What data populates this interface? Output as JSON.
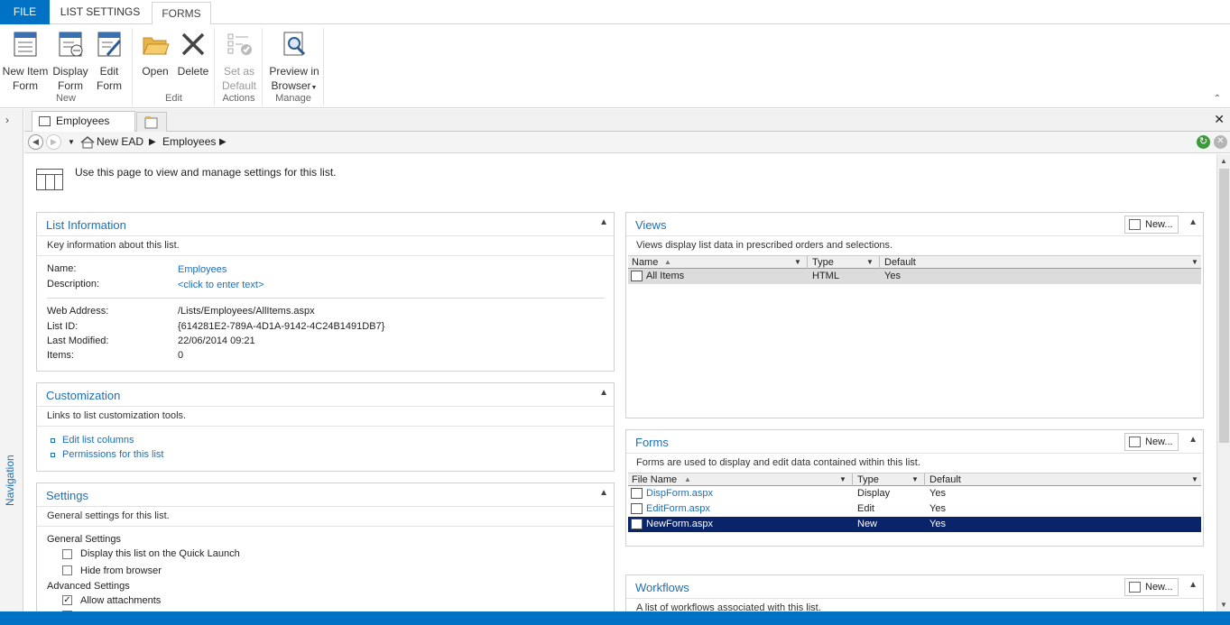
{
  "ribbon": {
    "tabs": [
      "FILE",
      "LIST SETTINGS",
      "FORMS"
    ],
    "groups": {
      "new": {
        "label": "New",
        "new_item_form": [
          "New Item",
          "Form"
        ],
        "display_form": [
          "Display",
          "Form"
        ],
        "edit_form": [
          "Edit",
          "Form"
        ]
      },
      "edit": {
        "label": "Edit",
        "open": "Open",
        "delete": "Delete"
      },
      "actions": {
        "label": "Actions",
        "set_default": [
          "Set as",
          "Default"
        ]
      },
      "manage": {
        "label": "Manage",
        "preview": [
          "Preview in",
          "Browser"
        ]
      }
    }
  },
  "nav": {
    "label": "Navigation"
  },
  "doc_tab": {
    "label": "Employees"
  },
  "breadcrumb": {
    "site": "New EAD",
    "list": "Employees"
  },
  "page": {
    "description": "Use this page to view and manage settings for this list."
  },
  "list_info": {
    "title": "List Information",
    "desc": "Key information about this list.",
    "name_label": "Name:",
    "name_value": "Employees",
    "description_label": "Description:",
    "description_value": "<click to enter text>",
    "web_address_label": "Web Address:",
    "web_address_value": "/Lists/Employees/AllItems.aspx",
    "list_id_label": "List ID:",
    "list_id_value": "{614281E2-789A-4D1A-9142-4C24B1491DB7}",
    "last_modified_label": "Last Modified:",
    "last_modified_value": "22/06/2014 09:21",
    "items_label": "Items:",
    "items_value": "0"
  },
  "customization": {
    "title": "Customization",
    "desc": "Links to list customization tools.",
    "links": [
      "Edit list columns",
      "Permissions for this list"
    ]
  },
  "settings": {
    "title": "Settings",
    "desc": "General settings for this list.",
    "general_label": "General Settings",
    "quick_launch": "Display this list on the Quick Launch",
    "hide_browser": "Hide from browser",
    "advanced_label": "Advanced Settings",
    "allow_attachments": "Allow attachments"
  },
  "views": {
    "title": "Views",
    "new_label": "New...",
    "desc": "Views display list data in prescribed orders and selections.",
    "columns": [
      "Name",
      "Type",
      "Default"
    ],
    "rows": [
      {
        "name": "All Items",
        "type": "HTML",
        "default": "Yes"
      }
    ]
  },
  "forms": {
    "title": "Forms",
    "new_label": "New...",
    "desc": "Forms are used to display and edit data contained within this list.",
    "columns": [
      "File Name",
      "Type",
      "Default"
    ],
    "rows": [
      {
        "name": "DispForm.aspx",
        "type": "Display",
        "default": "Yes"
      },
      {
        "name": "EditForm.aspx",
        "type": "Edit",
        "default": "Yes"
      },
      {
        "name": "NewForm.aspx",
        "type": "New",
        "default": "Yes"
      }
    ]
  },
  "workflows": {
    "title": "Workflows",
    "new_label": "New...",
    "desc": "A list of workflows associated with this list."
  }
}
